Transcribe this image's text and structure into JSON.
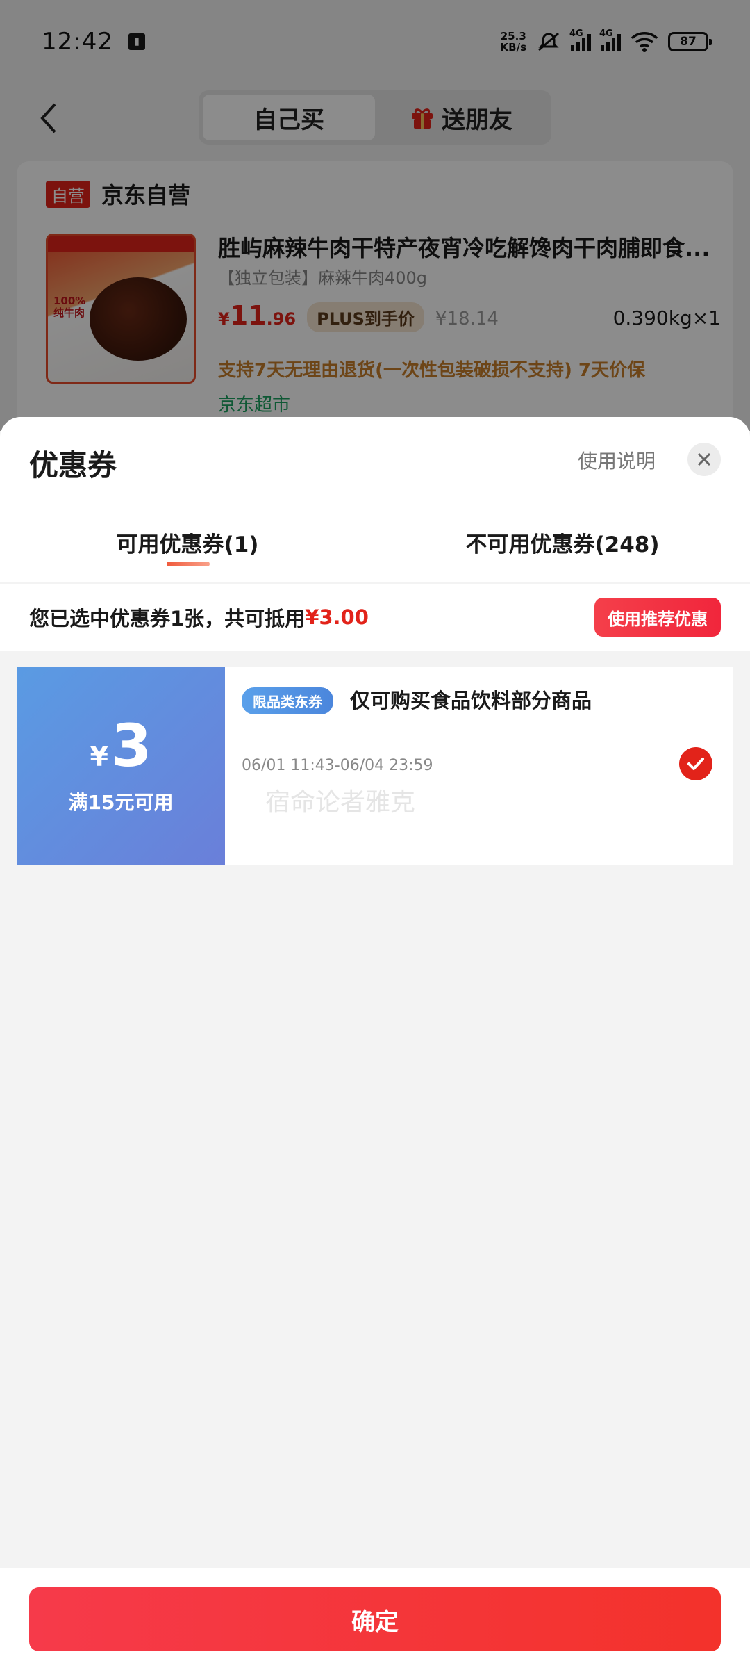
{
  "status": {
    "time": "12:42",
    "net_speed_value": "25.3",
    "net_speed_unit": "KB/s",
    "net_type_1": "4G",
    "net_type_2": "4G",
    "battery": "87"
  },
  "nav": {
    "tab_self": "自己买",
    "tab_gift": "送朋友"
  },
  "store": {
    "tag": "自营",
    "name": "京东自营"
  },
  "product": {
    "title": "胜屿麻辣牛肉干特产夜宵冷吃解馋肉干肉脯即食...",
    "spec": "【独立包装】麻辣牛肉400g",
    "price_yen": "¥",
    "price_int": "11",
    "price_dec": ".96",
    "plus_label": "PLUS到手价",
    "orig_price": "¥18.14",
    "qty": "0.390kg×1",
    "return_note": "支持7天无理由退货(一次性包装破损不支持) 7天价保",
    "market": "京东超市",
    "img_badge": "100% 纯牛肉"
  },
  "sheet": {
    "title": "优惠券",
    "help": "使用说明",
    "tab_available": "可用优惠券(1)",
    "tab_unavailable": "不可用优惠券(248)",
    "selected_prefix": "您已选中优惠券1张，共可抵用",
    "selected_amount": "¥3.00",
    "recommend_btn": "使用推荐优惠"
  },
  "coupon": {
    "yen": "¥",
    "value": "3",
    "condition": "满15元可用",
    "category_tag": "限品类东券",
    "description": "仅可购买食品饮料部分商品",
    "date_range": "06/01 11:43-06/04 23:59",
    "watermark": "宿命论者雅克",
    "selected": true
  },
  "footer": {
    "confirm": "确定"
  },
  "colors": {
    "accent_red": "#e2231a",
    "coupon_blue": "#5a9be3"
  }
}
